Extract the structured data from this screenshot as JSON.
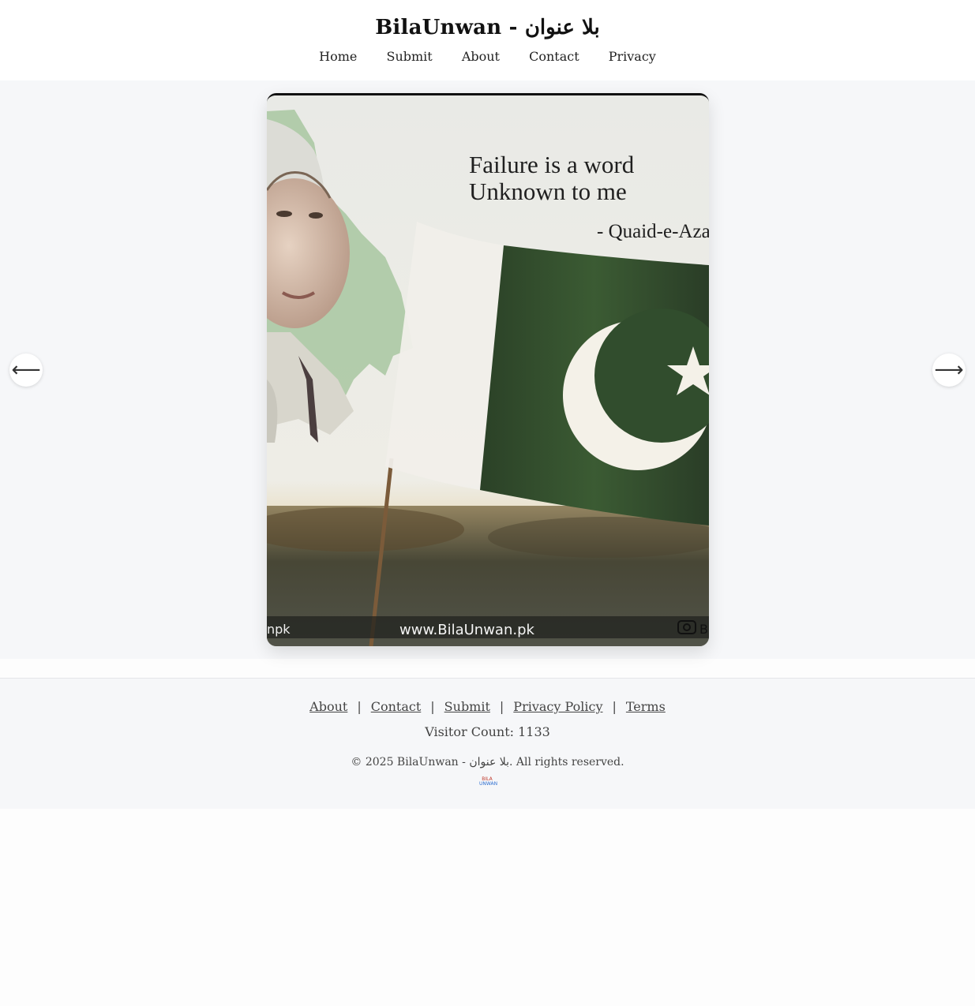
{
  "header": {
    "title": "BilaUnwan - بلا عنوان",
    "nav": [
      "Home",
      "Submit",
      "About",
      "Contact",
      "Privacy"
    ]
  },
  "slider": {
    "prev_arrow": "⟵",
    "next_arrow": "⟶",
    "slide": {
      "quote_line1": "Failure is a word",
      "quote_line2": "Unknown to me",
      "attribution": "- Quaid-e-Aza",
      "watermark_left": "npk",
      "watermark_center": "www.BilaUnwan.pk",
      "watermark_right": "B",
      "flag_green": "#2f4a2a",
      "flag_white": "#f1efea"
    }
  },
  "footer": {
    "links": [
      "About",
      "Contact",
      "Submit",
      "Privacy Policy",
      "Terms"
    ],
    "separator": "|",
    "visitor_count": "Visitor Count: 1133",
    "copyright": "© 2025 BilaUnwan - بلا عنوان. All rights reserved.",
    "logo_line1": "BILA",
    "logo_line2": "UNWAN"
  }
}
